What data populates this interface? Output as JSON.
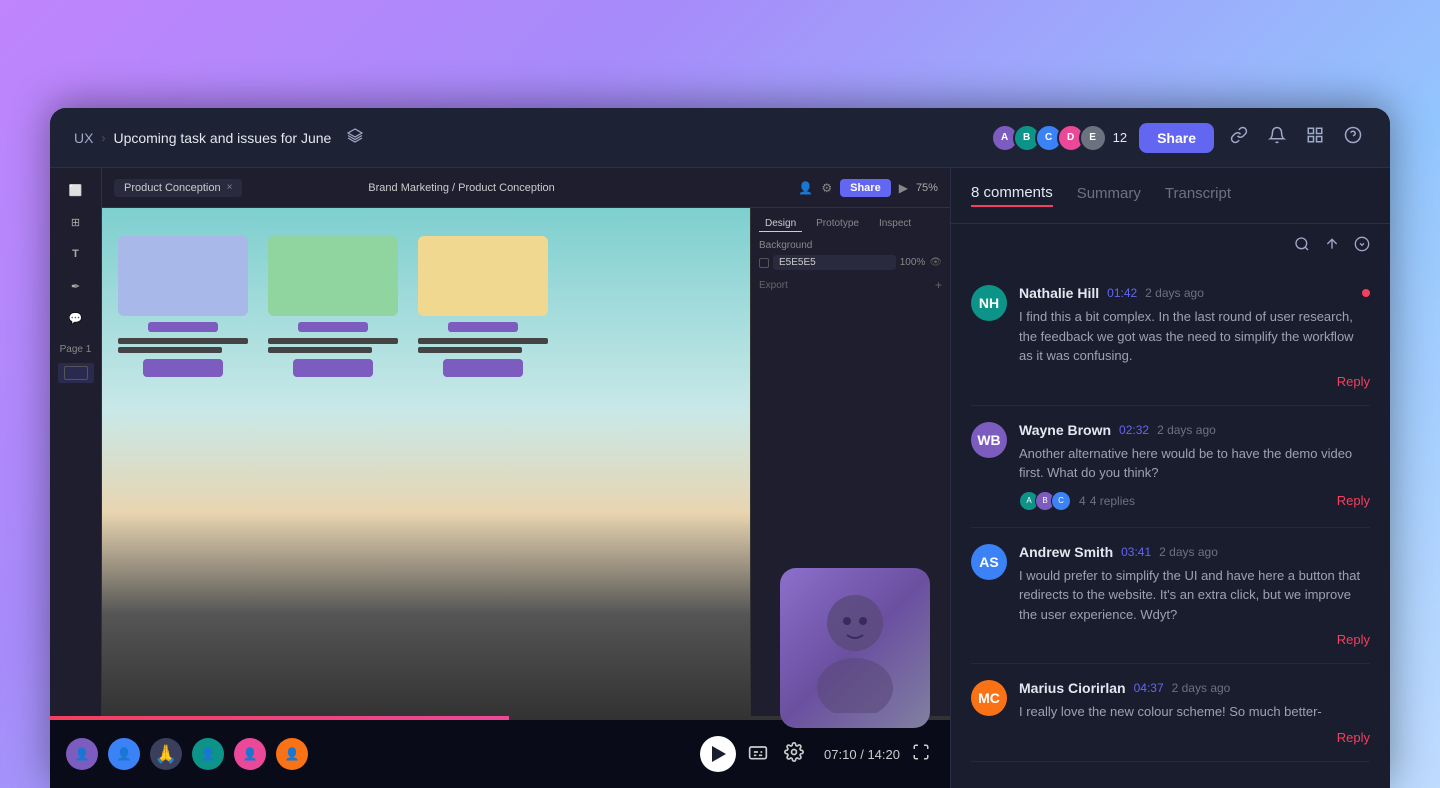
{
  "header": {
    "breadcrumb_prefix": "UX",
    "breadcrumb_current": "Upcoming task and issues for June",
    "share_btn": "Share",
    "avatar_count": "12",
    "icons": [
      "link-icon",
      "bell-icon",
      "grid-icon",
      "help-icon"
    ]
  },
  "figma": {
    "tab_name": "Product Conception",
    "breadcrumb": "Brand Marketing / Product Conception",
    "share_btn": "Share",
    "zoom": "75%",
    "design_tabs": [
      "Design",
      "Prototype",
      "Inspect"
    ],
    "active_design_tab": "Design",
    "background_label": "Background",
    "bg_color": "E5E5E5",
    "bg_opacity": "100%",
    "export_label": "Export",
    "page_label": "Page 1"
  },
  "controls": {
    "time_current": "07:10",
    "time_total": "14:20",
    "progress_percent": 51
  },
  "comments": {
    "tab_active": "8 comments",
    "tab_summary": "Summary",
    "tab_transcript": "Transcript",
    "items": [
      {
        "author": "Nathalie Hill",
        "initials": "NH",
        "timestamp": "01:42",
        "ago": "2 days ago",
        "text": "I find this a bit complex. In the last round of user research, the feedback we got was the need to simplify the workflow as it was confusing.",
        "has_dot": true,
        "replies_count": null,
        "reply_label": "Reply"
      },
      {
        "author": "Wayne Brown",
        "initials": "WB",
        "timestamp": "02:32",
        "ago": "2 days ago",
        "text": "Another alternative here would be to have the demo video first. What do you think?",
        "has_dot": false,
        "replies_count": "4",
        "replies_text": "4 replies",
        "reply_label": "Reply"
      },
      {
        "author": "Andrew Smith",
        "initials": "AS",
        "timestamp": "03:41",
        "ago": "2 days ago",
        "text": "I would prefer to simplify the UI and have here a button that redirects to the website. It's an extra click, but we improve the user experience. Wdyt?",
        "has_dot": false,
        "replies_count": null,
        "reply_label": "Reply"
      },
      {
        "author": "Marius Ciorirlan",
        "initials": "MC",
        "timestamp": "04:37",
        "ago": "2 days ago",
        "text": "I really love the new colour scheme! So much better-",
        "has_dot": false,
        "replies_count": null,
        "reply_label": "Reply"
      }
    ]
  }
}
